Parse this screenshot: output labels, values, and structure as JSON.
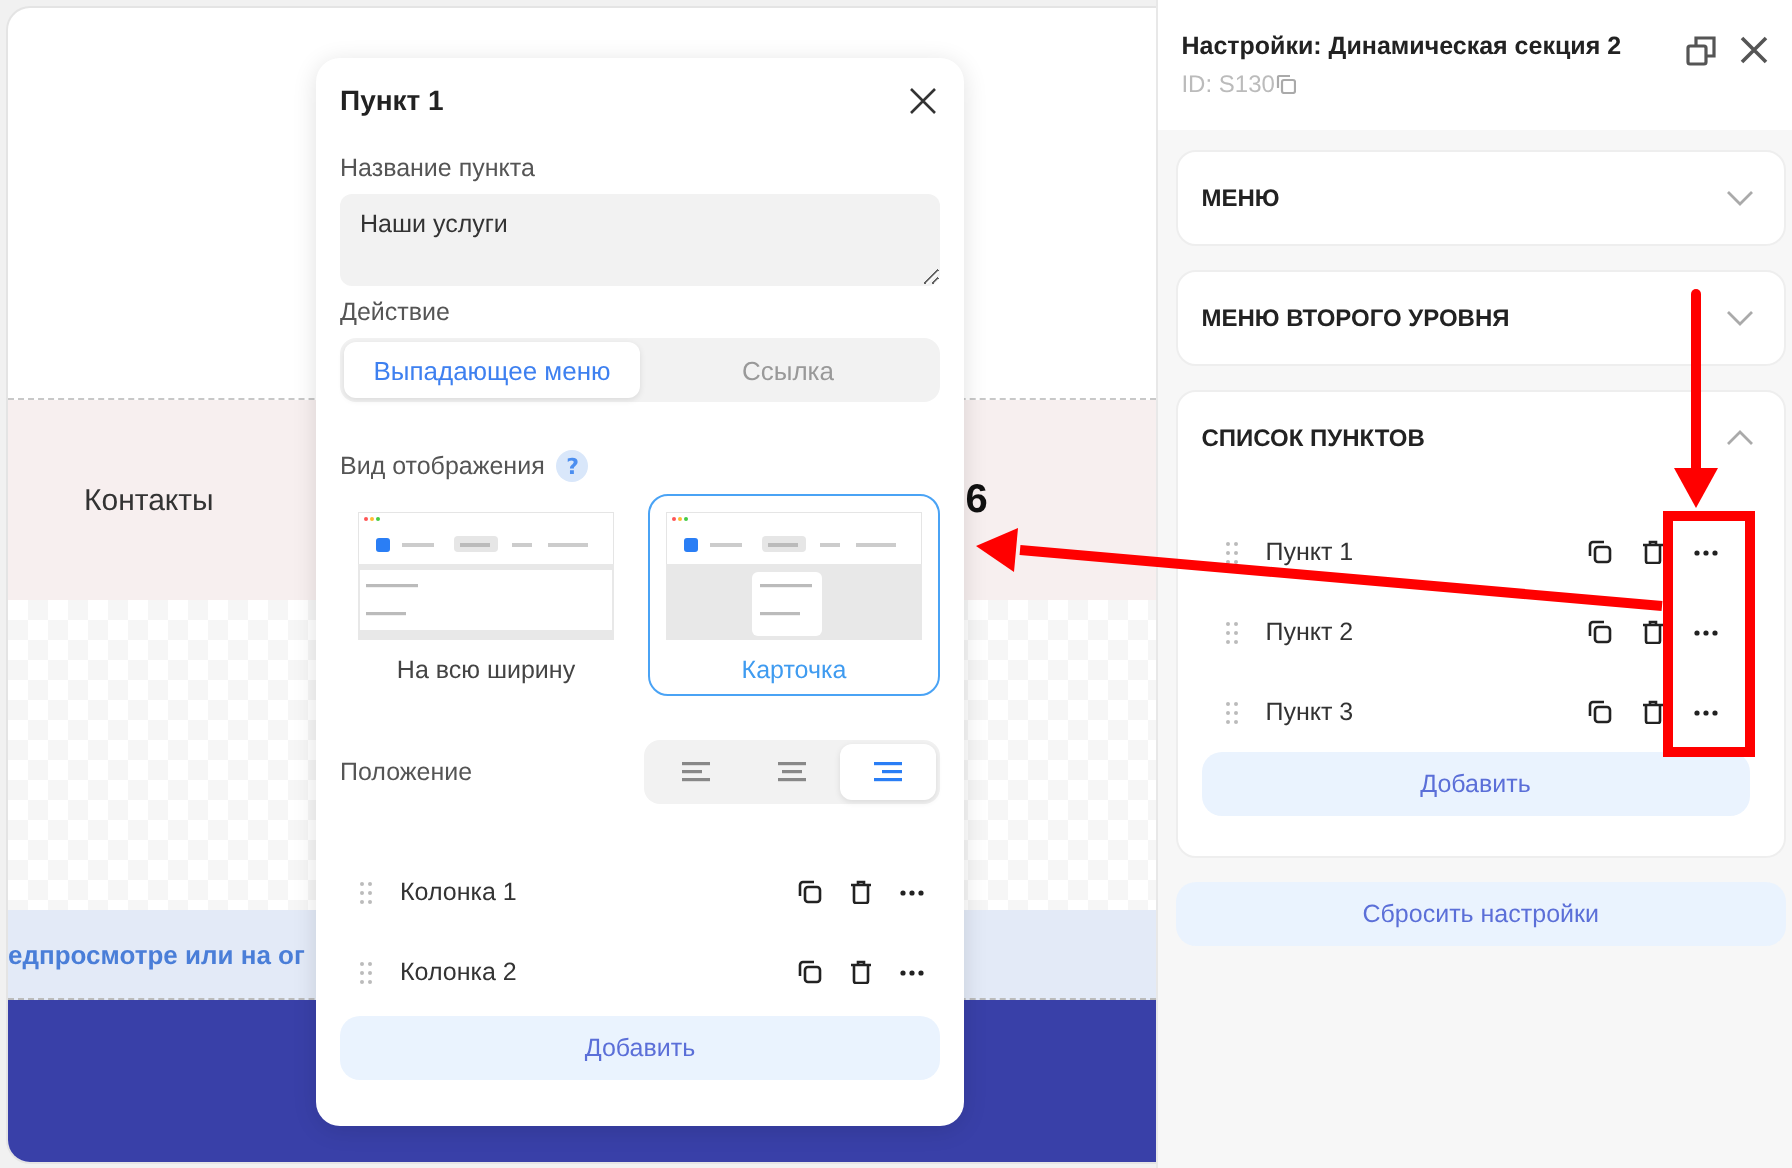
{
  "canvas": {
    "nav_link": "Контакты",
    "heading_fragment": "6",
    "notice_fragment": "едпросмотре или на ог"
  },
  "item_dialog": {
    "title": "Пункт 1",
    "name_label": "Название пункта",
    "name_value": "Наши услуги",
    "action_label": "Действие",
    "action_options": [
      {
        "label": "Выпадающее меню",
        "selected": true
      },
      {
        "label": "Ссылка",
        "selected": false
      }
    ],
    "display_label": "Вид отображения",
    "help": "?",
    "display_options": [
      {
        "label": "На всю ширину",
        "kind": "full",
        "selected": false
      },
      {
        "label": "Карточка",
        "kind": "card",
        "selected": true
      }
    ],
    "position_label": "Положение",
    "alignments": [
      {
        "kind": "left",
        "selected": false
      },
      {
        "kind": "center",
        "selected": false
      },
      {
        "kind": "right",
        "selected": true
      }
    ],
    "columns": [
      "Колонка 1",
      "Колонка 2"
    ],
    "add_button": "Добавить"
  },
  "settings_panel": {
    "title": "Настройки: Динамическая секция 2",
    "id": "ID: S130",
    "sections": [
      {
        "title": "МЕНЮ",
        "expanded": false
      },
      {
        "title": "МЕНЮ ВТОРОГО УРОВНЯ",
        "expanded": false
      },
      {
        "title": "СПИСОК ПУНКТОВ",
        "expanded": true,
        "items": [
          "Пункт 1",
          "Пункт 2",
          "Пункт 3"
        ],
        "add_button": "Добавить"
      }
    ],
    "reset_button": "Сбросить настройки"
  }
}
